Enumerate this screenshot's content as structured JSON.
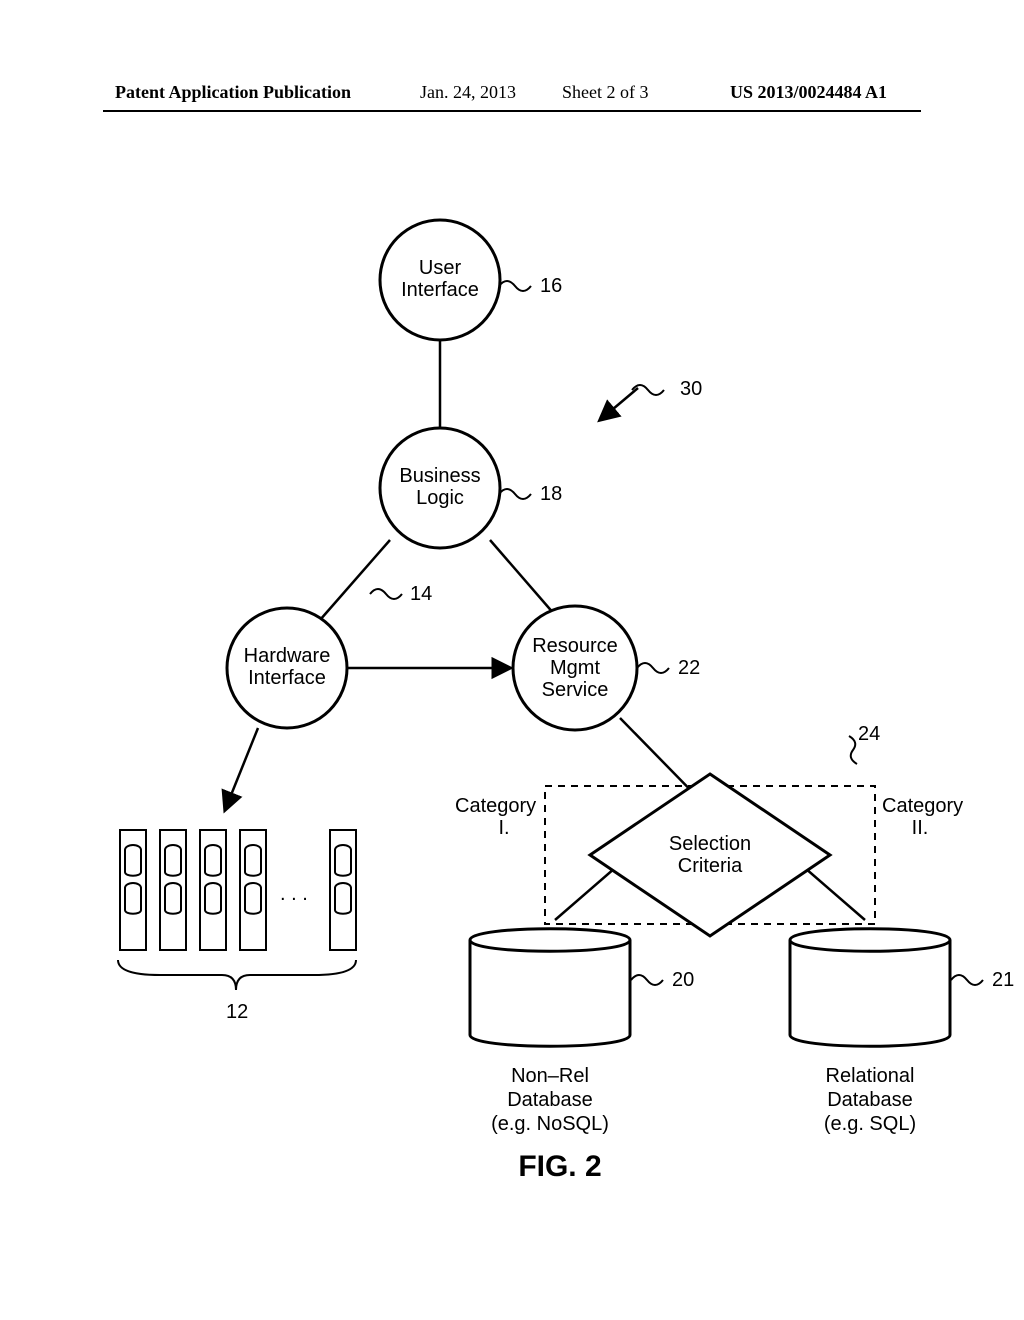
{
  "header": {
    "pub_type": "Patent Application Publication",
    "date": "Jan. 24, 2013",
    "sheet": "Sheet 2 of 3",
    "pubno": "US 2013/0024484 A1"
  },
  "nodes": {
    "ui": {
      "line1": "User",
      "line2": "Interface",
      "ref": "16"
    },
    "bl": {
      "line1": "Business",
      "line2": "Logic",
      "ref": "18"
    },
    "hw": {
      "line1": "Hardware",
      "line2": "Interface",
      "ref": "14"
    },
    "rms": {
      "line1": "Resource",
      "line2": "Mgmt",
      "line3": "Service",
      "ref": "22"
    },
    "sel": {
      "line1": "Selection",
      "line2": "Criteria",
      "ref": "24"
    },
    "cat1": {
      "label": "Category",
      "sub": "I."
    },
    "cat2": {
      "label": "Category",
      "sub": "II."
    },
    "db_left": {
      "line1": "Non–Rel",
      "line2": "Database",
      "line3": "(e.g.  NoSQL)",
      "ref": "20"
    },
    "db_right": {
      "line1": "Relational",
      "line2": "Database",
      "line3": "(e.g.  SQL)",
      "ref": "21"
    },
    "blades": {
      "ref": "12",
      "ellipsis": ". . ."
    }
  },
  "overall_ref": "30",
  "figure_caption": "FIG.  2"
}
